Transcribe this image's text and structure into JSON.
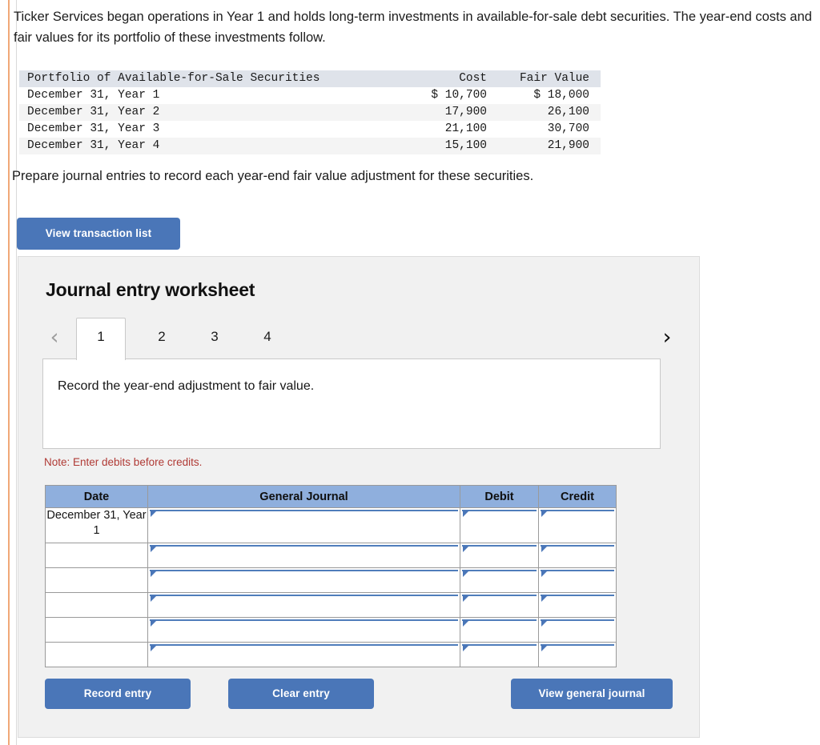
{
  "intro": {
    "paragraph": "Ticker Services began operations in Year 1 and holds long-term investments in available-for-sale debt securities. The year-end costs and fair values for its portfolio of these investments follow."
  },
  "portfolio_table": {
    "headers": [
      "Portfolio of Available-for-Sale Securities",
      "Cost",
      "Fair Value"
    ],
    "rows": [
      {
        "label": "December 31, Year 1",
        "cost": "$ 10,700",
        "fair_value": "$ 18,000"
      },
      {
        "label": "December 31, Year 2",
        "cost": "17,900",
        "fair_value": "26,100"
      },
      {
        "label": "December 31, Year 3",
        "cost": "21,100",
        "fair_value": "30,700"
      },
      {
        "label": "December 31, Year 4",
        "cost": "15,100",
        "fair_value": "21,900"
      }
    ]
  },
  "prompt": {
    "text": "Prepare journal entries to record each year-end fair value adjustment for these securities."
  },
  "buttons": {
    "view_transaction_list": "View transaction list",
    "record_entry": "Record entry",
    "clear_entry": "Clear entry",
    "view_general_journal": "View general journal"
  },
  "worksheet": {
    "title": "Journal entry worksheet",
    "tabs": [
      {
        "label": "1",
        "active": true
      },
      {
        "label": "2",
        "active": false
      },
      {
        "label": "3",
        "active": false
      },
      {
        "label": "4",
        "active": false
      }
    ],
    "prev_arrow_icon": "chevron-left-icon",
    "next_arrow_icon": "chevron-right-icon",
    "prev_arrow_glyph": "‹",
    "next_arrow_glyph": "›",
    "instruction": "Record the year-end adjustment to fair value.",
    "note": "Note: Enter debits before credits."
  },
  "journal_table": {
    "headers": [
      "Date",
      "General Journal",
      "Debit",
      "Credit"
    ],
    "rows": [
      {
        "date": "December 31, Year 1",
        "general_journal": "",
        "debit": "",
        "credit": ""
      },
      {
        "date": "",
        "general_journal": "",
        "debit": "",
        "credit": ""
      },
      {
        "date": "",
        "general_journal": "",
        "debit": "",
        "credit": ""
      },
      {
        "date": "",
        "general_journal": "",
        "debit": "",
        "credit": ""
      },
      {
        "date": "",
        "general_journal": "",
        "debit": "",
        "credit": ""
      },
      {
        "date": "",
        "general_journal": "",
        "debit": "",
        "credit": ""
      }
    ]
  },
  "colors": {
    "button_blue": "#4a76b8",
    "table_header_blue": "#8fafdd",
    "note_red": "#b03a35",
    "panel_gray": "#f1f1f1",
    "rail_orange": "#f0a878",
    "portfolio_header_gray": "#dfe3ea"
  }
}
